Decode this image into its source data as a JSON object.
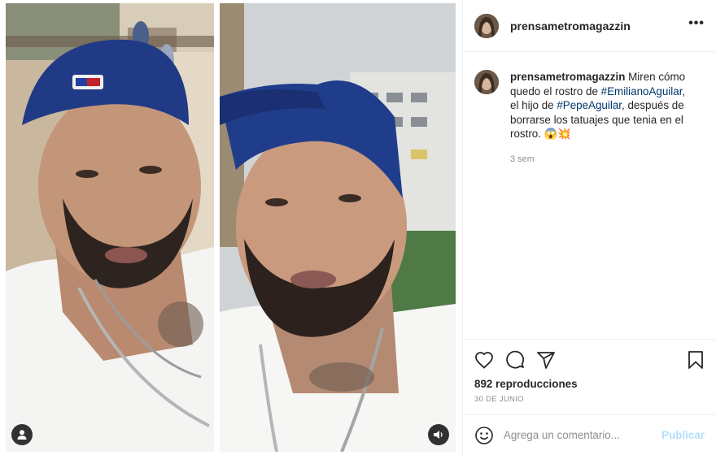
{
  "post": {
    "username": "prensametromagazzin",
    "more_label": "•••",
    "caption": {
      "username": "prensametromagazzin",
      "text_1": " Miren cómo quedo el rostro de ",
      "hashtag_1": "#EmilianoAguilar",
      "text_2": ", el hijo de ",
      "hashtag_2": "#PepeAguilar",
      "text_3": ", después de borrarse los tatuajes que tenia en el rostro. ",
      "emojis": "😱💥",
      "time": "3 sem"
    },
    "views": "892 reproducciones",
    "date": "30 DE JUNIO",
    "comment_placeholder": "Agrega un comentario...",
    "publish_label": "Publicar"
  },
  "icons": {
    "like": "heart-icon",
    "comment": "comment-icon",
    "share": "share-icon",
    "save": "bookmark-icon",
    "emoji": "emoji-icon",
    "user_tag": "user-tag-icon",
    "audio": "speaker-icon",
    "more": "more-options-icon"
  },
  "colors": {
    "hashtag": "#00376b",
    "publish_disabled": "#b2dffc",
    "muted_text": "#8e8e8e",
    "divider": "#efefef"
  }
}
